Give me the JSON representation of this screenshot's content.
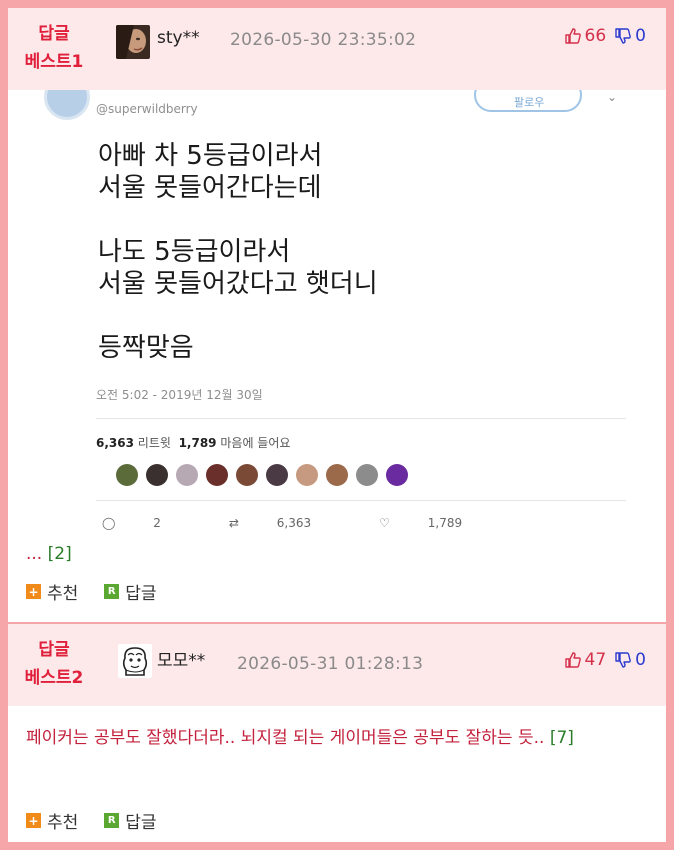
{
  "comments": [
    {
      "badge_line1": "답글",
      "badge_line2": "베스트1",
      "nickname": "sty**",
      "date": "2026-05-30 23:35:02",
      "upvotes": "66",
      "downvotes": "0",
      "tweet": {
        "handle": "@superwildberry",
        "follow_label": "팔로우",
        "lines": [
          "아빠 차 5등급이라서",
          "서울 못들어간다는데",
          "",
          "나도 5등급이라서",
          "서울 못들어갔다고 햇더니",
          "",
          "등짝맞음"
        ],
        "time": "오전 5:02 - 2019년 12월 30일",
        "retweets": "6,363",
        "retweets_label": "리트윗",
        "likes": "1,789",
        "likes_label": "마음에 들어요",
        "reply_count": "2",
        "retweet_count": "6,363",
        "like_count": "1,789"
      },
      "ellipsis": "...",
      "reply_count": "[2]",
      "recommend_label": "추천",
      "reply_label": "답글"
    },
    {
      "badge_line1": "답글",
      "badge_line2": "베스트2",
      "nickname": "모모**",
      "date": "2026-05-31 01:28:13",
      "upvotes": "47",
      "downvotes": "0",
      "text": "페이커는 공부도 잘했다더라.. 뇌지컬 되는 게이머들은 공부도 잘하는 듯..",
      "reply_count": "[7]",
      "recommend_label": "추천",
      "reply_label": "답글"
    }
  ],
  "colors": {
    "accent_red": "#e0203b",
    "border_pink": "#f6a5a9",
    "header_bg": "#fde8ea",
    "count_green": "#2b7d2b",
    "down_blue": "#2a3bd0",
    "recommend_orange": "#f08b1a",
    "reply_green": "#5aa832"
  }
}
